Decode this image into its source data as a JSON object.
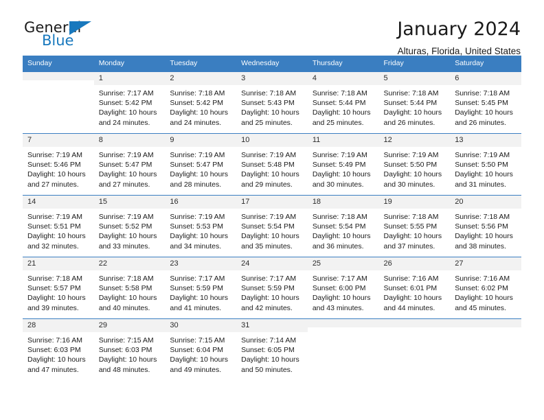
{
  "brand": {
    "name_top": "General",
    "name_bottom": "Blue",
    "accent_color": "#1878bd"
  },
  "header": {
    "title": "January 2024",
    "location": "Alturas, Florida, United States"
  },
  "calendar": {
    "header_color": "#3a7ec1",
    "daynum_bg": "#f2f2f2",
    "weekdays": [
      "Sunday",
      "Monday",
      "Tuesday",
      "Wednesday",
      "Thursday",
      "Friday",
      "Saturday"
    ],
    "weeks": [
      [
        {
          "day": "",
          "blank": true
        },
        {
          "day": "1",
          "sunrise": "Sunrise: 7:17 AM",
          "sunset": "Sunset: 5:42 PM",
          "daylight": "Daylight: 10 hours and 24 minutes."
        },
        {
          "day": "2",
          "sunrise": "Sunrise: 7:18 AM",
          "sunset": "Sunset: 5:42 PM",
          "daylight": "Daylight: 10 hours and 24 minutes."
        },
        {
          "day": "3",
          "sunrise": "Sunrise: 7:18 AM",
          "sunset": "Sunset: 5:43 PM",
          "daylight": "Daylight: 10 hours and 25 minutes."
        },
        {
          "day": "4",
          "sunrise": "Sunrise: 7:18 AM",
          "sunset": "Sunset: 5:44 PM",
          "daylight": "Daylight: 10 hours and 25 minutes."
        },
        {
          "day": "5",
          "sunrise": "Sunrise: 7:18 AM",
          "sunset": "Sunset: 5:44 PM",
          "daylight": "Daylight: 10 hours and 26 minutes."
        },
        {
          "day": "6",
          "sunrise": "Sunrise: 7:18 AM",
          "sunset": "Sunset: 5:45 PM",
          "daylight": "Daylight: 10 hours and 26 minutes."
        }
      ],
      [
        {
          "day": "7",
          "sunrise": "Sunrise: 7:19 AM",
          "sunset": "Sunset: 5:46 PM",
          "daylight": "Daylight: 10 hours and 27 minutes."
        },
        {
          "day": "8",
          "sunrise": "Sunrise: 7:19 AM",
          "sunset": "Sunset: 5:47 PM",
          "daylight": "Daylight: 10 hours and 27 minutes."
        },
        {
          "day": "9",
          "sunrise": "Sunrise: 7:19 AM",
          "sunset": "Sunset: 5:47 PM",
          "daylight": "Daylight: 10 hours and 28 minutes."
        },
        {
          "day": "10",
          "sunrise": "Sunrise: 7:19 AM",
          "sunset": "Sunset: 5:48 PM",
          "daylight": "Daylight: 10 hours and 29 minutes."
        },
        {
          "day": "11",
          "sunrise": "Sunrise: 7:19 AM",
          "sunset": "Sunset: 5:49 PM",
          "daylight": "Daylight: 10 hours and 30 minutes."
        },
        {
          "day": "12",
          "sunrise": "Sunrise: 7:19 AM",
          "sunset": "Sunset: 5:50 PM",
          "daylight": "Daylight: 10 hours and 30 minutes."
        },
        {
          "day": "13",
          "sunrise": "Sunrise: 7:19 AM",
          "sunset": "Sunset: 5:50 PM",
          "daylight": "Daylight: 10 hours and 31 minutes."
        }
      ],
      [
        {
          "day": "14",
          "sunrise": "Sunrise: 7:19 AM",
          "sunset": "Sunset: 5:51 PM",
          "daylight": "Daylight: 10 hours and 32 minutes."
        },
        {
          "day": "15",
          "sunrise": "Sunrise: 7:19 AM",
          "sunset": "Sunset: 5:52 PM",
          "daylight": "Daylight: 10 hours and 33 minutes."
        },
        {
          "day": "16",
          "sunrise": "Sunrise: 7:19 AM",
          "sunset": "Sunset: 5:53 PM",
          "daylight": "Daylight: 10 hours and 34 minutes."
        },
        {
          "day": "17",
          "sunrise": "Sunrise: 7:19 AM",
          "sunset": "Sunset: 5:54 PM",
          "daylight": "Daylight: 10 hours and 35 minutes."
        },
        {
          "day": "18",
          "sunrise": "Sunrise: 7:18 AM",
          "sunset": "Sunset: 5:54 PM",
          "daylight": "Daylight: 10 hours and 36 minutes."
        },
        {
          "day": "19",
          "sunrise": "Sunrise: 7:18 AM",
          "sunset": "Sunset: 5:55 PM",
          "daylight": "Daylight: 10 hours and 37 minutes."
        },
        {
          "day": "20",
          "sunrise": "Sunrise: 7:18 AM",
          "sunset": "Sunset: 5:56 PM",
          "daylight": "Daylight: 10 hours and 38 minutes."
        }
      ],
      [
        {
          "day": "21",
          "sunrise": "Sunrise: 7:18 AM",
          "sunset": "Sunset: 5:57 PM",
          "daylight": "Daylight: 10 hours and 39 minutes."
        },
        {
          "day": "22",
          "sunrise": "Sunrise: 7:18 AM",
          "sunset": "Sunset: 5:58 PM",
          "daylight": "Daylight: 10 hours and 40 minutes."
        },
        {
          "day": "23",
          "sunrise": "Sunrise: 7:17 AM",
          "sunset": "Sunset: 5:59 PM",
          "daylight": "Daylight: 10 hours and 41 minutes."
        },
        {
          "day": "24",
          "sunrise": "Sunrise: 7:17 AM",
          "sunset": "Sunset: 5:59 PM",
          "daylight": "Daylight: 10 hours and 42 minutes."
        },
        {
          "day": "25",
          "sunrise": "Sunrise: 7:17 AM",
          "sunset": "Sunset: 6:00 PM",
          "daylight": "Daylight: 10 hours and 43 minutes."
        },
        {
          "day": "26",
          "sunrise": "Sunrise: 7:16 AM",
          "sunset": "Sunset: 6:01 PM",
          "daylight": "Daylight: 10 hours and 44 minutes."
        },
        {
          "day": "27",
          "sunrise": "Sunrise: 7:16 AM",
          "sunset": "Sunset: 6:02 PM",
          "daylight": "Daylight: 10 hours and 45 minutes."
        }
      ],
      [
        {
          "day": "28",
          "sunrise": "Sunrise: 7:16 AM",
          "sunset": "Sunset: 6:03 PM",
          "daylight": "Daylight: 10 hours and 47 minutes."
        },
        {
          "day": "29",
          "sunrise": "Sunrise: 7:15 AM",
          "sunset": "Sunset: 6:03 PM",
          "daylight": "Daylight: 10 hours and 48 minutes."
        },
        {
          "day": "30",
          "sunrise": "Sunrise: 7:15 AM",
          "sunset": "Sunset: 6:04 PM",
          "daylight": "Daylight: 10 hours and 49 minutes."
        },
        {
          "day": "31",
          "sunrise": "Sunrise: 7:14 AM",
          "sunset": "Sunset: 6:05 PM",
          "daylight": "Daylight: 10 hours and 50 minutes."
        },
        {
          "day": "",
          "blank": true
        },
        {
          "day": "",
          "blank": true
        },
        {
          "day": "",
          "blank": true
        }
      ]
    ]
  }
}
